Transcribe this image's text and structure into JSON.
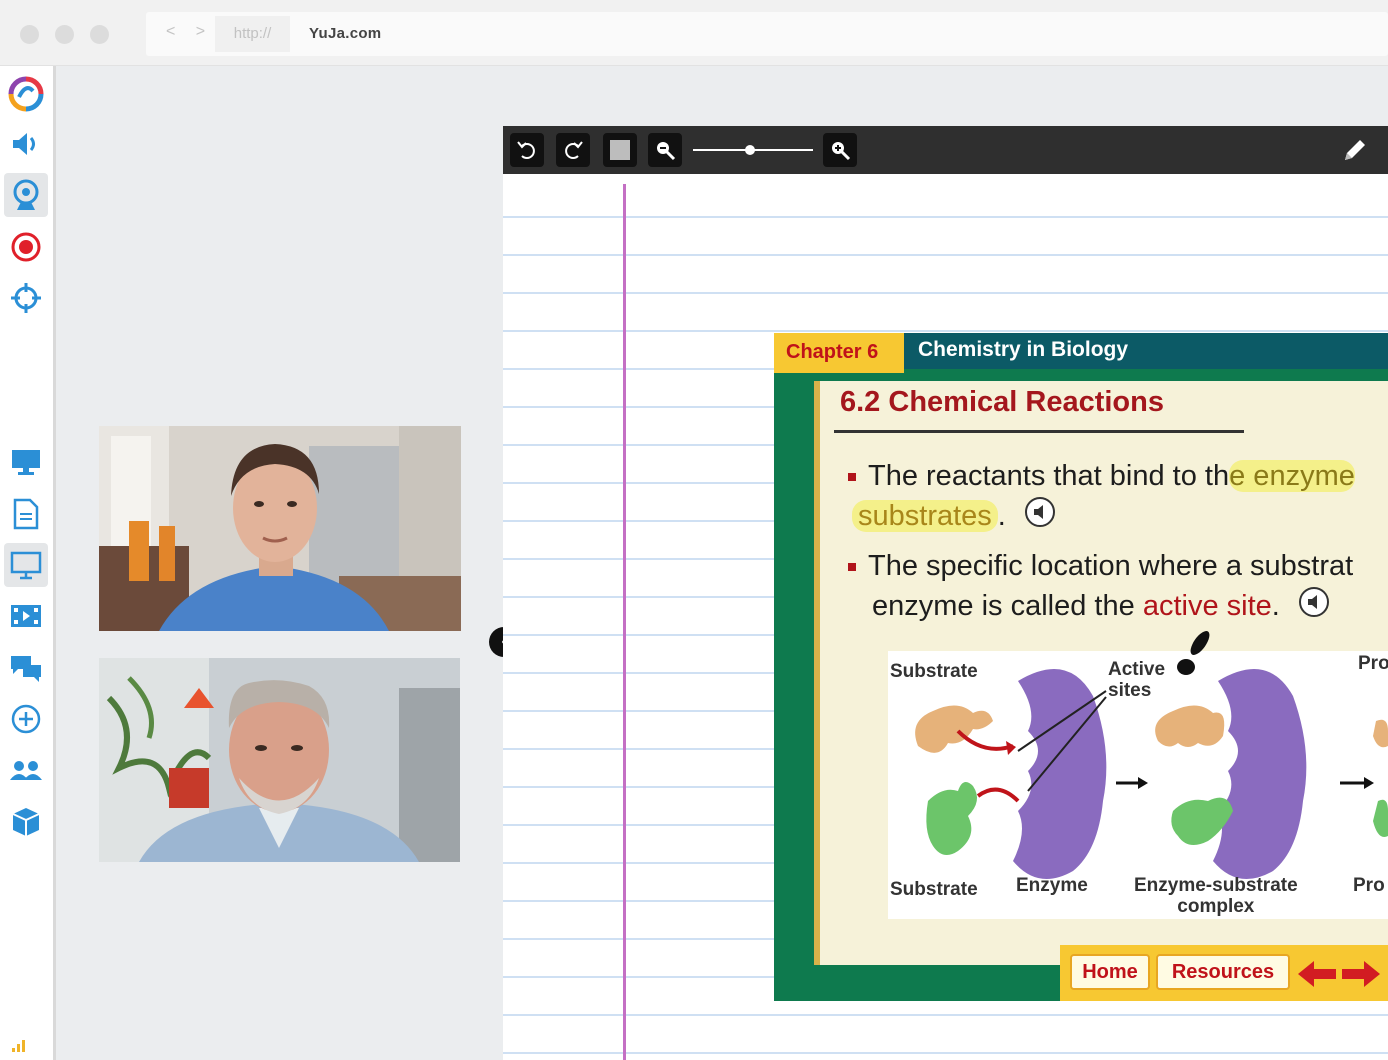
{
  "browser": {
    "protocol": "http://",
    "url": "YuJa.com",
    "nav_arrows": "< >"
  },
  "sidebar": {
    "items": [
      {
        "name": "yuja-logo-icon"
      },
      {
        "name": "speaker-icon"
      },
      {
        "name": "webcam-icon",
        "active": true
      },
      {
        "name": "record-icon"
      },
      {
        "name": "crosshair-icon"
      },
      {
        "name": "monitor-icon"
      },
      {
        "name": "document-icon"
      },
      {
        "name": "presentation-icon",
        "active": true
      },
      {
        "name": "video-icon"
      },
      {
        "name": "chat-icon"
      },
      {
        "name": "add-icon"
      },
      {
        "name": "users-icon"
      },
      {
        "name": "cube-icon"
      }
    ],
    "accent_color": "#2b8fd6"
  },
  "whiteboard": {
    "toolbar": {
      "tools": [
        "undo-icon",
        "redo-icon",
        "stop-icon",
        "zoom-out-icon",
        "zoom-slider",
        "zoom-in-icon",
        "pencil-icon"
      ],
      "zoom_level": 0.5
    },
    "collapse_arrow": "‹"
  },
  "slide": {
    "chapter": "Chapter 6",
    "chapter_title": "Chemistry in Biology",
    "section_title": "6.2 Chemical Reactions",
    "bullet1_line1_pre": "The reactants that bind to th",
    "bullet1_line1_hl": "e enzyme",
    "bullet1_line2_hl": "substrates",
    "bullet1_line2_post": ".",
    "bullet2_line1": "The specific location where a substrat",
    "bullet2_line2_pre": "enzyme is called the ",
    "bullet2_line2_red": "active site",
    "bullet2_line2_post": ".",
    "diagram": {
      "substrate_top": "Substrate",
      "active_sites": "Active\nsites",
      "products_partial": "Pro",
      "substrate_bottom": "Substrate",
      "enzyme": "Enzyme",
      "complex": "Enzyme-substrate\ncomplex",
      "products_bottom_partial": "Pro"
    },
    "nav": {
      "home": "Home",
      "resources": "Resources"
    },
    "colors": {
      "chapter_tab": "#f7c832",
      "header": "#0c5a66",
      "frame": "#0e7a4e",
      "title_red": "#a4171d",
      "highlight": "#f4f08a"
    }
  }
}
